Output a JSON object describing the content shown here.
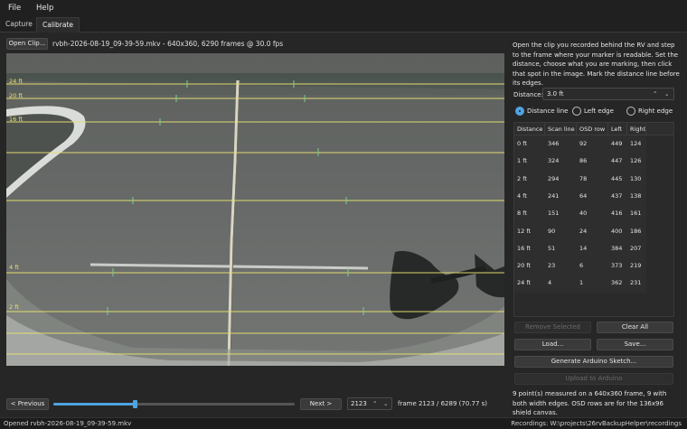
{
  "menu": {
    "file": "File",
    "help": "Help"
  },
  "tabs": [
    {
      "label": "Capture"
    },
    {
      "label": "Calibrate"
    }
  ],
  "toolbar": {
    "open_clip": "Open Clip...",
    "file_info": "rvbh-2026-08-19_09-39-59.mkv - 640x360, 6290 frames @ 30.0 fps"
  },
  "overlay_labels": [
    "24 ft",
    "20 ft",
    "16 ft",
    "4 ft",
    "2 ft"
  ],
  "instructions": "Open the clip you recorded behind the RV and step to the frame where your marker is readable. Set the distance, choose what you are marking, then click that spot in the image. Mark the distance line before its edges.",
  "distance": {
    "label": "Distance:",
    "value": "3.0 ft"
  },
  "mark_mode": {
    "distance_line": "Distance line",
    "left_edge": "Left edge",
    "right_edge": "Right edge",
    "selected": "distance_line"
  },
  "table": {
    "headers": [
      "Distance",
      "Scan line",
      "OSD row",
      "Left",
      "Right"
    ],
    "rows": [
      [
        "0 ft",
        "346",
        "92",
        "449",
        "124"
      ],
      [
        "1 ft",
        "324",
        "86",
        "447",
        "126"
      ],
      [
        "2 ft",
        "294",
        "78",
        "445",
        "130"
      ],
      [
        "4 ft",
        "241",
        "64",
        "437",
        "138"
      ],
      [
        "8 ft",
        "151",
        "40",
        "416",
        "161"
      ],
      [
        "12 ft",
        "90",
        "24",
        "400",
        "186"
      ],
      [
        "16 ft",
        "51",
        "14",
        "384",
        "207"
      ],
      [
        "20 ft",
        "23",
        "6",
        "373",
        "219"
      ],
      [
        "24 ft",
        "4",
        "1",
        "362",
        "231"
      ]
    ]
  },
  "buttons": {
    "remove_selected": "Remove Selected",
    "clear_all": "Clear All",
    "load": "Load...",
    "save": "Save...",
    "generate_sketch": "Generate Arduino Sketch...",
    "upload": "Upload to Arduino"
  },
  "summary": "9 point(s) measured on a 640x360 frame, 9 with both width edges. OSD rows are for the 136x96 shield canvas.",
  "navigation": {
    "previous": "< Previous",
    "next": "Next >",
    "frame_value": "2123",
    "frame_info": "frame 2123 / 6289  (70.77 s)",
    "position_fraction": 0.3375
  },
  "status": {
    "left": "Opened rvbh-2026-08-19_09-39-59.mkv",
    "right": "Recordings: W:\\projects\\26rvBackupHelper\\recordings"
  },
  "colors": {
    "accent": "#4fa3e0",
    "overlay_line": "#e8e070"
  }
}
